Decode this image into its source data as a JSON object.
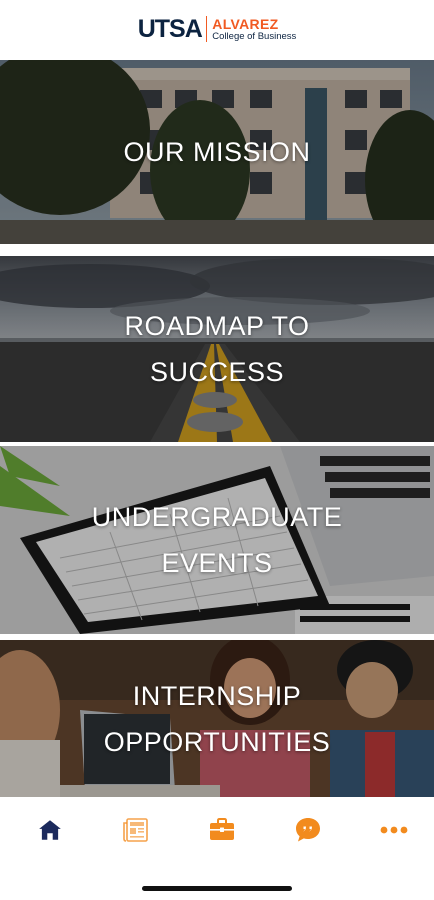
{
  "header": {
    "logo_utsa": "UTSA",
    "logo_alvarez": "ALVAREZ",
    "logo_college": "College of Business",
    "colors": {
      "navy": "#0c2340",
      "orange": "#f15a22"
    }
  },
  "tiles": [
    {
      "label": "OUR MISSION",
      "image": "campus-building-photo"
    },
    {
      "label": "ROADMAP TO\nSUCCESS",
      "image": "road-horizon-photo"
    },
    {
      "label": "UNDERGRADUATE\nEVENTS",
      "image": "planner-laptop-desk-photo"
    },
    {
      "label": "INTERNSHIP\nOPPORTUNITIES",
      "image": "students-laptop-photo"
    }
  ],
  "bottom_nav": {
    "items": [
      {
        "icon": "home-icon",
        "active": true
      },
      {
        "icon": "newspaper-icon",
        "active": false
      },
      {
        "icon": "briefcase-icon",
        "active": false
      },
      {
        "icon": "quote-bubble-icon",
        "active": false
      },
      {
        "icon": "more-icon",
        "active": false
      }
    ],
    "active_color": "#1b2a5c",
    "inactive_color": "#f28b1e"
  }
}
